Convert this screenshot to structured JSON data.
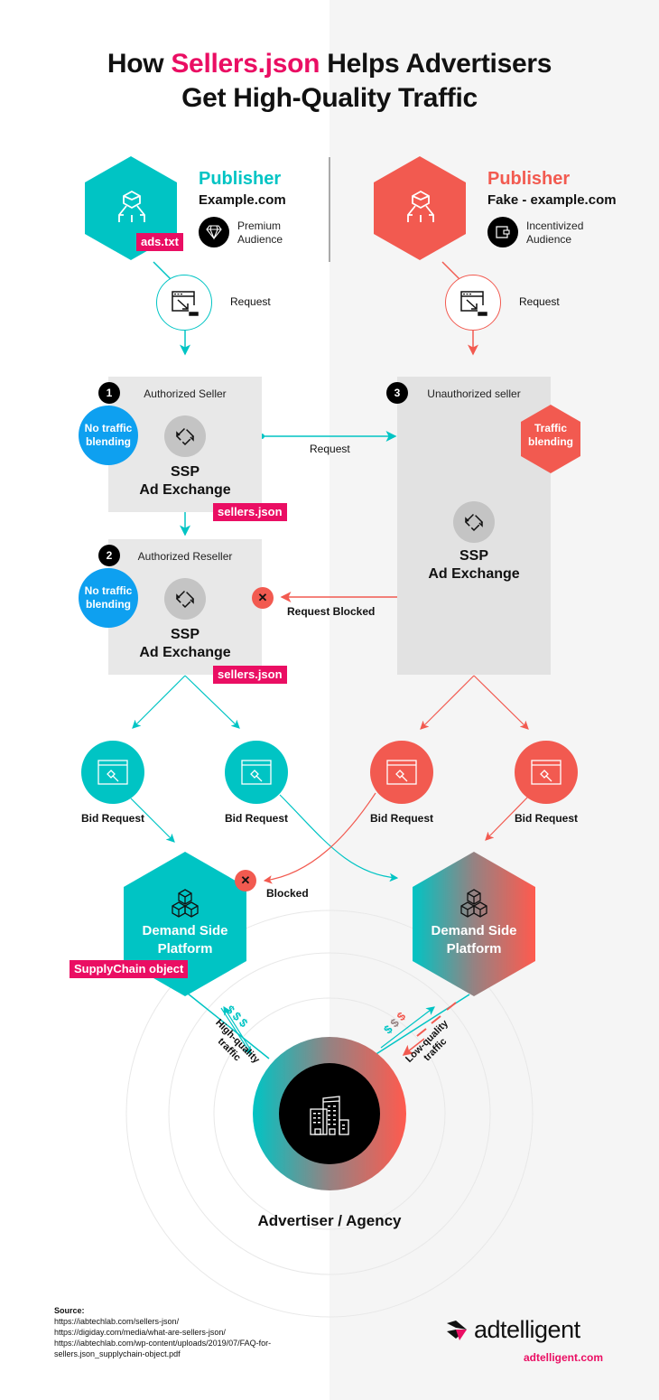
{
  "title": {
    "prefix": "How ",
    "highlight": "Sellers.json",
    "suffix": " Helps Advertisers",
    "line2": "Get High-Quality Traffic"
  },
  "colors": {
    "teal": "#00c4c4",
    "coral": "#f25a50",
    "pink": "#ea0e63",
    "blue": "#0ea0f0",
    "box_gray": "#e8e8e8",
    "right_bg": "#f5f5f5"
  },
  "left_publisher": {
    "title": "Publisher",
    "site": "Example.com",
    "audience_icon": "diamond-icon",
    "audience_line1": "Premium",
    "audience_line2": "Audience",
    "tag": "ads.txt",
    "request_label": "Request"
  },
  "right_publisher": {
    "title": "Publisher",
    "site": "Fake - example.com",
    "audience_icon": "wallet-icon",
    "audience_line1": "Incentivized",
    "audience_line2": "Audience",
    "request_label": "Request"
  },
  "sellers": [
    {
      "number": "1",
      "title": "Authorized Seller",
      "blend": "No traffic blending",
      "ssp_line1": "SSP",
      "ssp_line2": "Ad Exchange",
      "tag": "sellers.json"
    },
    {
      "number": "2",
      "title": "Authorized Reseller",
      "blend": "No traffic blending",
      "ssp_line1": "SSP",
      "ssp_line2": "Ad Exchange",
      "tag": "sellers.json"
    },
    {
      "number": "3",
      "title": "Unauthorized seller",
      "blend": "Traffic blending",
      "ssp_line1": "SSP",
      "ssp_line2": "Ad Exchange"
    }
  ],
  "flows": {
    "request": "Request",
    "request_blocked": "Request Blocked",
    "blocked": "Blocked",
    "bid_request": "Bid Request",
    "high_quality": "High-quality traffic",
    "low_quality": "Low-quality traffic",
    "money_symbol": "$"
  },
  "dsp": {
    "left_line1": "Demand Side",
    "left_line2": "Platform",
    "right_line1": "Demand Side",
    "right_line2": "Platform",
    "supply_chain_tag": "SupplyChain object"
  },
  "advertiser": {
    "label": "Advertiser / Agency",
    "icon": "buildings-icon"
  },
  "source": {
    "heading": "Source:",
    "links": [
      "https://iabtechlab.com/sellers-json/",
      "https://digiday.com/media/what-are-sellers-json/",
      "https://iabtechlab.com/wp-content/uploads/2019/07/FAQ-for-",
      "sellers.json_supplychain-object.pdf"
    ]
  },
  "brand": {
    "name": "adtelligent",
    "url": "adtelligent.com"
  }
}
